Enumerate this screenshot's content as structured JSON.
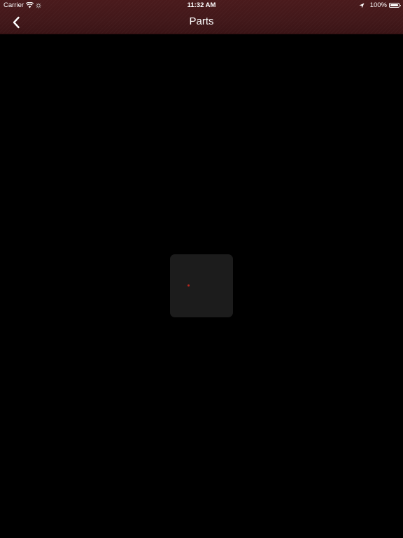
{
  "status_bar": {
    "carrier": "Carrier",
    "time": "11:32 AM",
    "battery": "100%",
    "battery_level": 1.0,
    "icons": [
      "wifi-icon",
      "activity-icon",
      "location-icon",
      "battery-icon"
    ]
  },
  "nav": {
    "title": "Parts",
    "back_icon": "chevron-left-icon"
  },
  "loading": {
    "icon": "spinner-icon",
    "accent_color": "#b5261e"
  },
  "colors": {
    "header_background": "#42181a",
    "content_background": "#000000",
    "hud_background": "#1c1c1c"
  }
}
